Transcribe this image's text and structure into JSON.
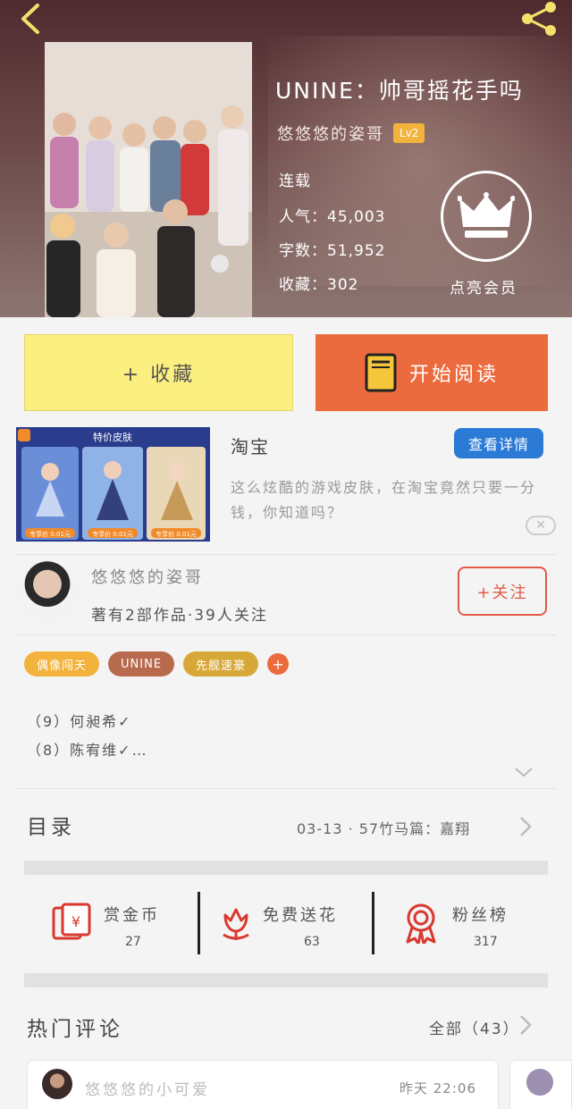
{
  "header": {
    "title": "UNINE：帅哥摇花手吗",
    "author": "悠悠悠的姿哥",
    "author_level": "Lv2",
    "status": "连载",
    "popularity": "人气：45,003",
    "word_count": "字数：51,952",
    "favorites": "收藏：302",
    "crown_label": "点亮会员"
  },
  "actions": {
    "favorite_label": "+ 收藏",
    "read_label": "开始阅读"
  },
  "ad": {
    "banner_caption": "特价皮肤",
    "price_tags": [
      "专享价 0.01元",
      "专享价 0.01元",
      "专享价 0.01元"
    ],
    "title": "淘宝",
    "detail_button": "查看详情",
    "description": "这么炫酷的游戏皮肤，在淘宝竟然只要一分钱，你知道吗？",
    "close_label": "✕"
  },
  "author_block": {
    "name": "悠悠悠的姿哥",
    "stats": "著有2部作品·39人关注",
    "follow_label": "+关注"
  },
  "tags": [
    {
      "label": "偶像闯天",
      "color": "#f2b23c"
    },
    {
      "label": "UNINE",
      "color": "#b86a4f"
    },
    {
      "label": "先舰速豪",
      "color": "#d7a837"
    }
  ],
  "characters": [
    "（9）何昶希✓",
    "（8）陈宥维✓…"
  ],
  "toc": {
    "label": "目录",
    "latest": "03-13 · 57竹马篇：嘉翔"
  },
  "stats": [
    {
      "label": "赏金币",
      "value": "27",
      "icon": "red-envelope-icon"
    },
    {
      "label": "免费送花",
      "value": "63",
      "icon": "flower-icon"
    },
    {
      "label": "粉丝榜",
      "value": "317",
      "icon": "medal-icon"
    }
  ],
  "comments": {
    "section_label": "热门评论",
    "all_label": "全部（43）",
    "items": [
      {
        "user": "悠悠悠的小可爱",
        "time": "昨天 22:06"
      }
    ]
  },
  "colors": {
    "accent_orange": "#ec6b3e",
    "accent_yellow": "#fbf07f",
    "link_blue": "#2b7ad6",
    "follow_red": "#e05b49"
  }
}
